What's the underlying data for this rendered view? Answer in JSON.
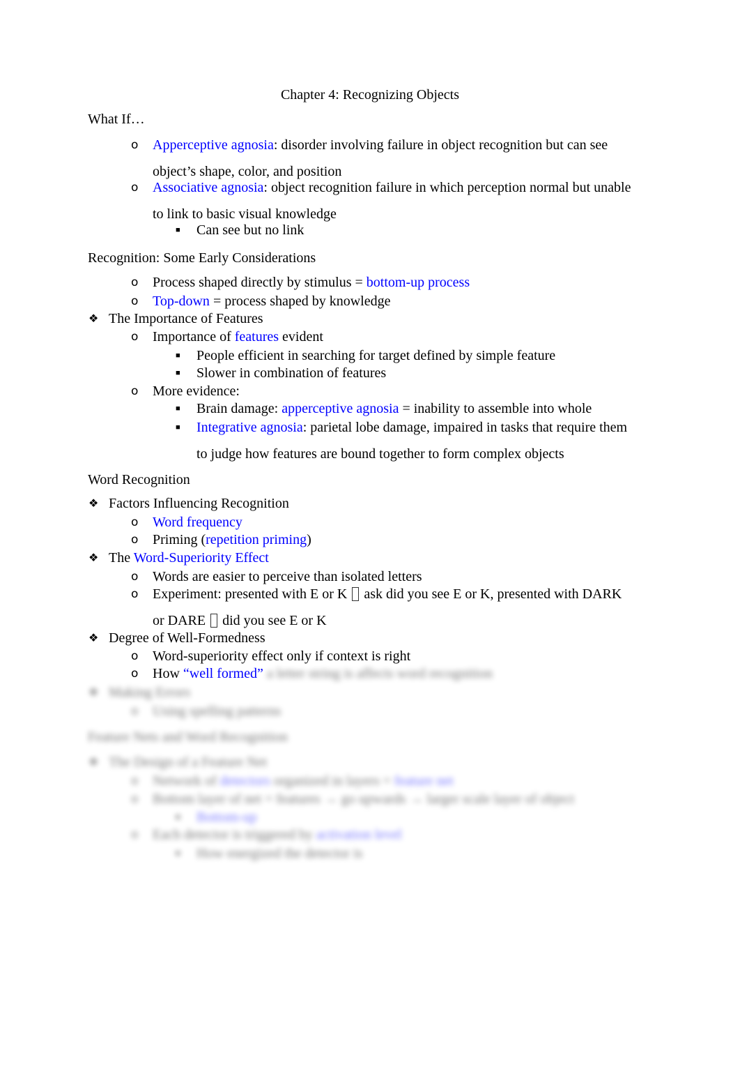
{
  "title": "Chapter 4: Recognizing Objects",
  "sections": {
    "what_if": {
      "heading": "What If…",
      "items": [
        {
          "term": "Apperceptive agnosia",
          "rest_line1": ": disorder involving failure in object recognition but can see",
          "line2": "object’s shape, color, and position"
        },
        {
          "term": "Associative agnosia",
          "rest_line1": ": object recognition failure in which perception normal but unable",
          "line2": "to link to basic visual knowledge",
          "sub": [
            "Can see but no link"
          ]
        }
      ]
    },
    "early": {
      "heading": "Recognition: Some Early Considerations",
      "items": [
        {
          "pre": "Process shaped directly by stimulus = ",
          "term": "bottom-up process"
        },
        {
          "term": "Top-down",
          "post": " = process shaped by knowledge"
        }
      ],
      "features": {
        "heading": "The Importance of Features",
        "item1": {
          "pre": "Importance of ",
          "term": "features",
          "post": " evident",
          "sub": [
            "People efficient in searching for target defined by simple feature",
            "Slower in combination of features"
          ]
        },
        "item2": {
          "text": "More evidence:",
          "sub1": {
            "pre": "Brain damage: ",
            "term": "apperceptive agnosia",
            "post": " = inability to assemble into whole"
          },
          "sub2": {
            "term": "Integrative agnosia",
            "rest_line1": ": parietal lobe damage, impaired in tasks that require them",
            "line2": "to judge how features are bound together to form complex objects"
          }
        }
      }
    },
    "word": {
      "heading": "Word Recognition",
      "factors": {
        "heading": "Factors Influencing Recognition",
        "item1": "Word frequency",
        "item2": {
          "pre": "Priming (",
          "term": "repetition priming",
          "post": ")"
        }
      },
      "wse": {
        "pre": "The ",
        "term": "Word-Superiority Effect",
        "item1": "Words are easier to perceive than isolated letters",
        "item2": {
          "line1a": "Experiment: presented with E or K",
          "line1b": "ask did you see E or K, presented with DARK",
          "line2a": "or DARE",
          "line2b": "did you see E or K"
        }
      },
      "wellformed": {
        "heading": "Degree of Well-Formedness",
        "item1": "Word-superiority effect only if context is right",
        "item2": {
          "pre": "How ",
          "term": "“well formed”",
          "blurred": "a letter string is affects word recognition"
        }
      }
    },
    "blurred": {
      "making_errors": "Making Errors",
      "making_sub": "Using spelling patterns",
      "heading": "Feature Nets and Word Recognition",
      "design": "The Design of a Feature Net",
      "d1_pre": "Network of ",
      "d1_term": "detectors",
      "d1_mid": " organized in layers = ",
      "d1_term2": "feature net",
      "d2": "Bottom layer of net = features → go upwards → larger scale layer of object",
      "d2_sub": "Bottom-up",
      "d3_pre": "Each detector is triggered by ",
      "d3_term": "activation level",
      "d3_sub": "How energized the detector is"
    }
  }
}
